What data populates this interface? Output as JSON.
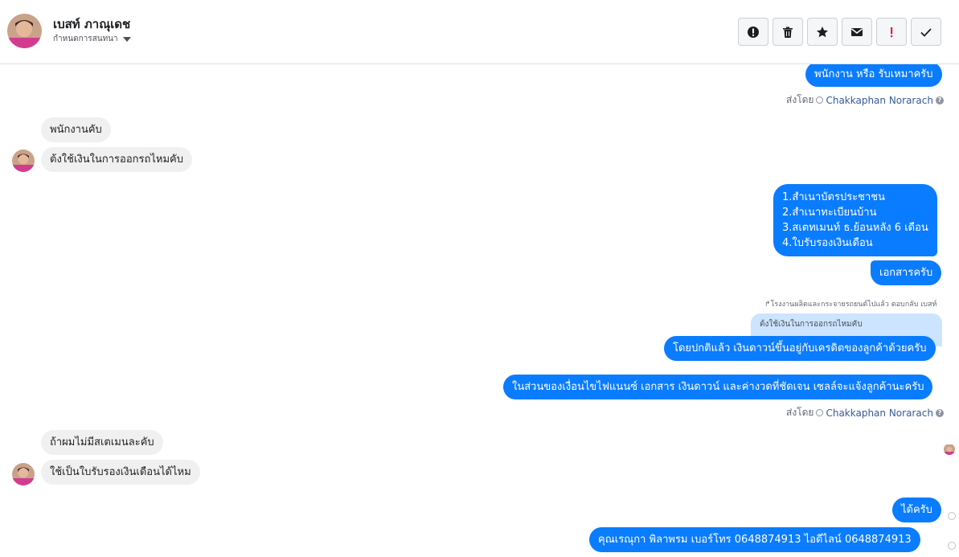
{
  "header": {
    "contact_name": "เบสท์ ภาณุเดช",
    "subtitle": "กำหนดการสนทนา",
    "toolbar": [
      {
        "name": "info-button",
        "icon": "alert-circle-icon"
      },
      {
        "name": "delete-button",
        "icon": "trash-icon"
      },
      {
        "name": "star-button",
        "icon": "star-icon"
      },
      {
        "name": "mark-unread-button",
        "icon": "envelope-icon"
      },
      {
        "name": "flag-button",
        "icon": "exclamation-icon"
      },
      {
        "name": "mark-done-button",
        "icon": "check-icon"
      }
    ]
  },
  "messages": {
    "m1": "พนักงาน หรือ รับเหมาครับ",
    "sentby1": {
      "prefix": "ส่งโดย",
      "agent": "Chakkaphan Norarach"
    },
    "m2": "พนักงานคับ",
    "m3": "ต้งใช้เงินในการออกรถไหมคับ",
    "m4": {
      "lines": [
        "1.สำเนาบัตรประชาชน",
        "2.สำเนาทะเบียนบ้าน",
        "3.สเตทเมนท์ ธ.ย้อนหลัง 6 เดือน",
        "4.ใบรับรองเงินเดือน"
      ]
    },
    "m5": "เอกสารครับ",
    "reply_note": "โรงงานผลิตและกระจายรถยนต์ไปแล้ว ตอบกลับ เบสท์",
    "quoted": "ต้งใช้เงินในการออกรถไหมคับ",
    "m6": "โดยปกติแล้ว เงินดาวน์ขึ้นอยู่กับเครดิตของลูกค้าด้วยครับ",
    "m7": "ในส่วนของเงื่อนไขไฟแนนซ์ เอกสาร เงินดาวน์ และค่างวดที่ชัดเจน เซลล์จะแจ้งลูกค้านะครับ",
    "sentby2": {
      "prefix": "ส่งโดย",
      "agent": "Chakkaphan Norarach"
    },
    "m8": "ถ้าผมไม่มีสเตเมนละคับ",
    "m9": "ใช้เป็นใบรับรองเงินเดือนได้ไหม",
    "m10": "ได้ครับ",
    "m11": "คุณเรณุกา พิลาพรม        เบอร์โทร 0648874913  ไอดีไลน์ 0648874913"
  },
  "colors": {
    "outgoing": "#0a7cff",
    "incoming": "#f1f0f0",
    "agent_link": "#385898",
    "quote_bg": "#cce4ff"
  }
}
